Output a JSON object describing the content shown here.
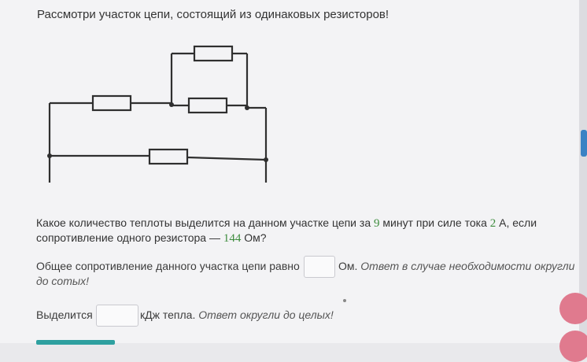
{
  "header": {
    "title": "Рассмотри участок цепи, состоящий из одинаковых резисторов!"
  },
  "question": {
    "part1": "Какое количество теплоты выделится на данном участке цепи за ",
    "minutes": "9",
    "part2": " минут при силе тока ",
    "current": "2",
    "part3": " А, если",
    "part4": "сопротивление одного резистора — ",
    "resistance": "144",
    "part5": " Ом?"
  },
  "answer1": {
    "prefix": "Общее сопротивление данного участка цепи равно",
    "value": "",
    "unit": "Ом.",
    "hint1": "Ответ в случае необходимости округли",
    "hint2": "до сотых!"
  },
  "answer2": {
    "prefix": "Выделится",
    "value": "",
    "unit": "кДж тепла.",
    "hint": "Ответ округли до целых!"
  },
  "colors": {
    "accent_number": "#3d8c3d",
    "scroll": "#3b82c4",
    "floating_button": "#e07a8e"
  }
}
